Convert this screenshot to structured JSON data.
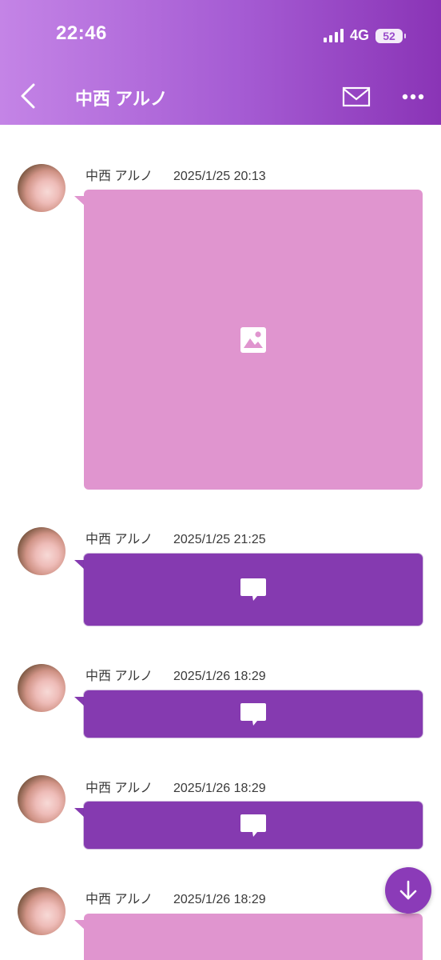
{
  "status_bar": {
    "time": "22:46",
    "network": "4G",
    "battery": "52"
  },
  "header": {
    "title": "中西 アルノ"
  },
  "messages": [
    {
      "name": "中西 アルノ",
      "timestamp": "2025/1/25 20:13",
      "type": "image",
      "icon": "image-icon"
    },
    {
      "name": "中西 アルノ",
      "timestamp": "2025/1/25 21:25",
      "type": "text",
      "icon": "chat-bubble-icon"
    },
    {
      "name": "中西 アルノ",
      "timestamp": "2025/1/26 18:29",
      "type": "text",
      "icon": "chat-bubble-icon"
    },
    {
      "name": "中西 アルノ",
      "timestamp": "2025/1/26 18:29",
      "type": "text",
      "icon": "chat-bubble-icon"
    },
    {
      "name": "中西 アルノ",
      "timestamp": "2025/1/26 18:29",
      "type": "image",
      "icon": "image-icon"
    }
  ],
  "colors": {
    "header_start": "#c484e6",
    "header_end": "#8a34b6",
    "image_bubble": "#e095cf",
    "text_bubble": "#853ab0",
    "fab": "#8b3bb8"
  }
}
